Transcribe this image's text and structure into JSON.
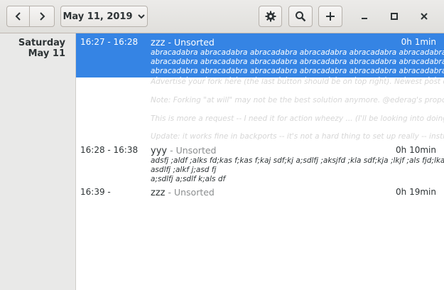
{
  "header": {
    "date_label": "May 11, 2019",
    "icons": {
      "back": "chevron-left-icon",
      "forward": "chevron-right-icon",
      "date_dropdown": "chevron-down-icon",
      "settings": "gear-icon",
      "search": "search-icon",
      "add": "plus-icon",
      "minimize": "minimize-icon",
      "maximize": "maximize-icon",
      "close": "close-icon"
    }
  },
  "day": {
    "weekday": "Saturday",
    "date": "May 11"
  },
  "colors": {
    "selection": "#3584e4",
    "category_text": "#8b8e8f"
  },
  "facts": [
    {
      "time": "16:27 - 16:28",
      "name": "zzz",
      "category": "- Unsorted",
      "duration": "0h 1min",
      "description": "abracadabra abracadabra abracadabra abracadabra abracadabra abracadabra\nabracadabra abracadabra abracadabra abracadabra abracadabra abracadabra\nabracadabra abracadabra abracadabra abracadabra abracadabra abracadabra\nabracadabra abracadabra abracadabra abracadabra abracadabra abracadabra",
      "selected": true
    },
    {
      "time": "16:28 - 16:38",
      "name": "yyy",
      "category": "- Unsorted",
      "duration": "0h 10min",
      "description": "adsfj ;aldf ;alks fd;kas f;kas f;kaj sdf;kj a;sdlfj ;aksjfd ;kla sdf;kja ;lkjf ;als fjd;lkasjdf ;lkjsadf\nasdlfj ;alkf j;asd fj\na;sdlfj a;sdlf k;als df",
      "selected": false
    },
    {
      "time": "16:39 -",
      "name": "zzz",
      "category": "- Unsorted",
      "duration": "0h 19min",
      "description": "",
      "selected": false
    }
  ],
  "ghost_lines": [
    "Advertise your fork here (the last button should be on top right). Newest post of the",
    "Note: Forking \"at will\" may not be the best solution anymore. @ederag's proposal",
    "This is more a request -- I need it for action wheezy ... (I'll be looking into doing it",
    "Update: it works fine in backports -- it's not a hard thing to set up really -- instructions"
  ]
}
